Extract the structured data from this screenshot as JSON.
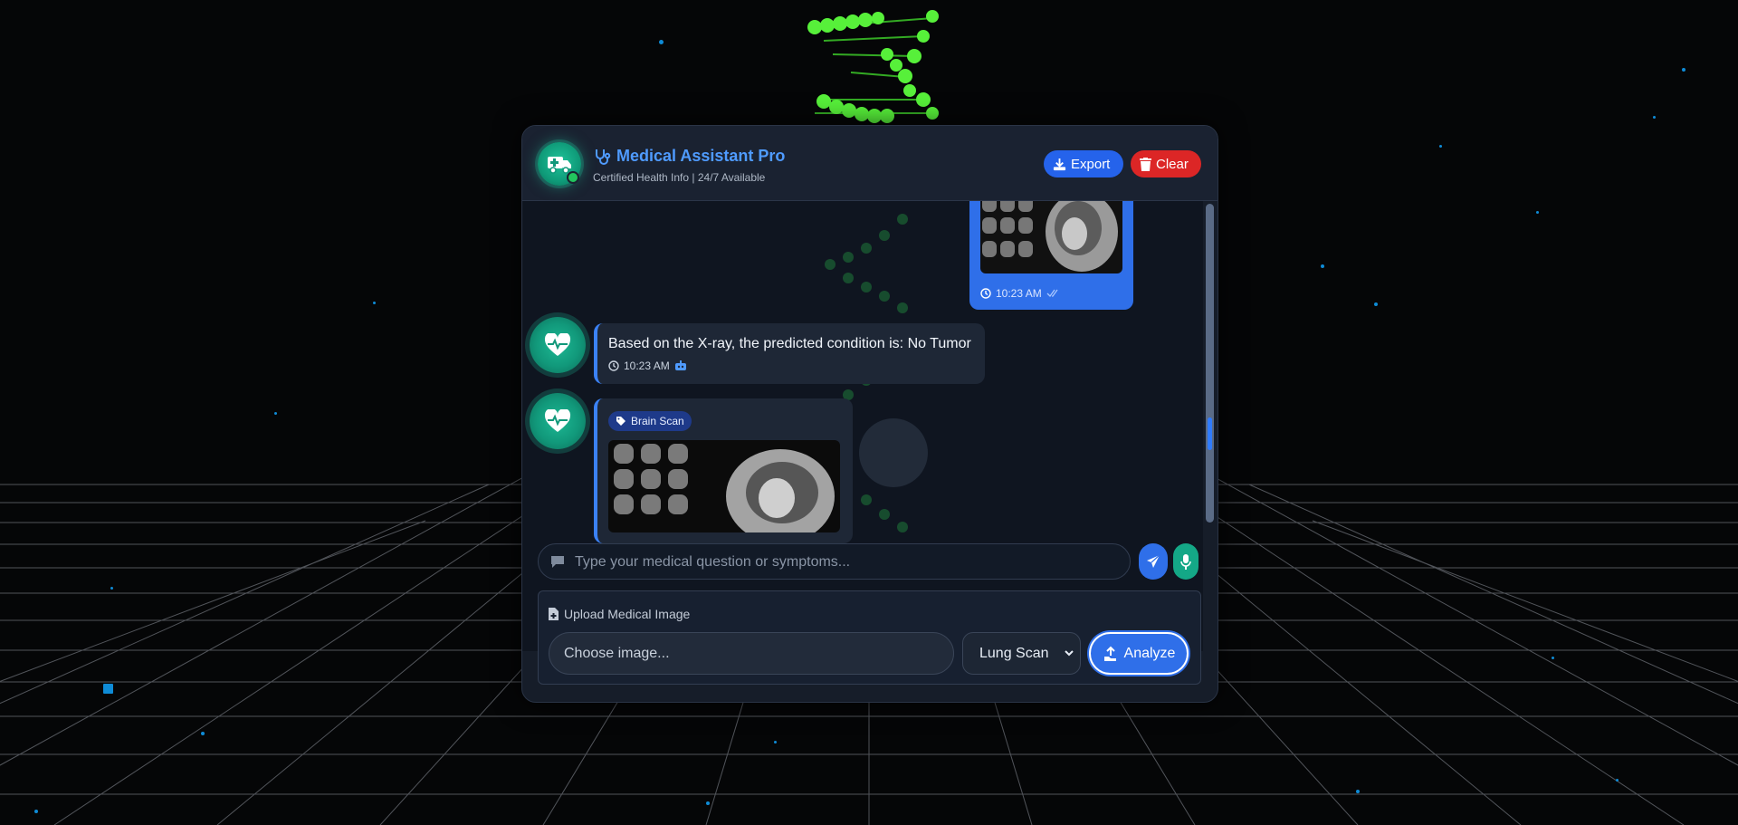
{
  "header": {
    "title": "Medical Assistant Pro",
    "subtitle": "Certified Health Info | 24/7 Available",
    "export_label": "Export",
    "clear_label": "Clear"
  },
  "messages": [
    {
      "role": "user",
      "type": "image",
      "time": "10:23 AM",
      "status_icon": "double-check-icon"
    },
    {
      "role": "bot",
      "type": "text",
      "text": "Based on the X-ray, the predicted condition is: No Tumor",
      "time": "10:23 AM",
      "status_icon": "robot-icon"
    },
    {
      "role": "bot",
      "type": "image",
      "tag": "Brain Scan"
    }
  ],
  "composer": {
    "placeholder": "Type your medical question or symptoms..."
  },
  "upload": {
    "label": "Upload Medical Image",
    "file_placeholder": "Choose image...",
    "scan_type_selected": "Lung Scan",
    "analyze_label": "Analyze"
  },
  "colors": {
    "accent_blue": "#2f6fe9",
    "danger_red": "#dc2626",
    "teal": "#14a887",
    "panel_bg": "#161d29"
  }
}
